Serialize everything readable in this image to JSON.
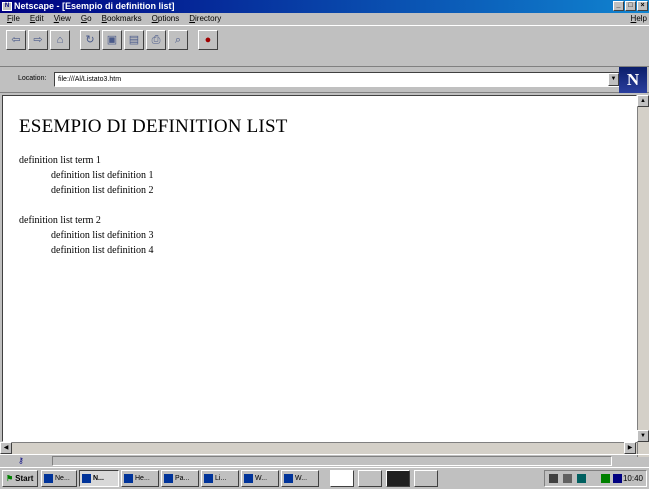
{
  "window": {
    "app_icon": "N",
    "title": "Netscape - [Esempio di definition list]",
    "buttons": [
      "_",
      "□",
      "×"
    ]
  },
  "menu": {
    "items": [
      "File",
      "Edit",
      "View",
      "Go",
      "Bookmarks",
      "Options",
      "Directory"
    ],
    "help": "Help"
  },
  "toolbar": {
    "buttons": [
      {
        "name": "back-icon",
        "glyph": "⇦"
      },
      {
        "name": "forward-icon",
        "glyph": "⇨"
      },
      {
        "name": "home-icon",
        "glyph": "⌂"
      },
      {
        "name": "reload-icon",
        "glyph": "↻"
      },
      {
        "name": "images-icon",
        "glyph": "▣"
      },
      {
        "name": "open-icon",
        "glyph": "▤"
      },
      {
        "name": "print-icon",
        "glyph": "⎙"
      },
      {
        "name": "find-icon",
        "glyph": "⌕"
      },
      {
        "name": "stop-icon",
        "glyph": "●"
      }
    ]
  },
  "location": {
    "label": "Location:",
    "value": "file:///Al/Listato3.htm",
    "logo": "N"
  },
  "page": {
    "heading": "ESEMPIO DI DEFINITION LIST",
    "list": [
      {
        "term": "definition list term 1",
        "definitions": [
          "definition list definition 1",
          "definition list definition 2"
        ]
      },
      {
        "term": "definition list term 2",
        "definitions": [
          "definition list definition 3",
          "definition list definition 4"
        ]
      }
    ]
  },
  "statusbar": {
    "security_icon": "key-icon",
    "text": ""
  },
  "taskbar": {
    "start": "Start",
    "tasks": [
      "Ne...",
      "N...",
      "He...",
      "Pa...",
      "Li...",
      "W...",
      "W..."
    ],
    "clock": "10:40"
  }
}
